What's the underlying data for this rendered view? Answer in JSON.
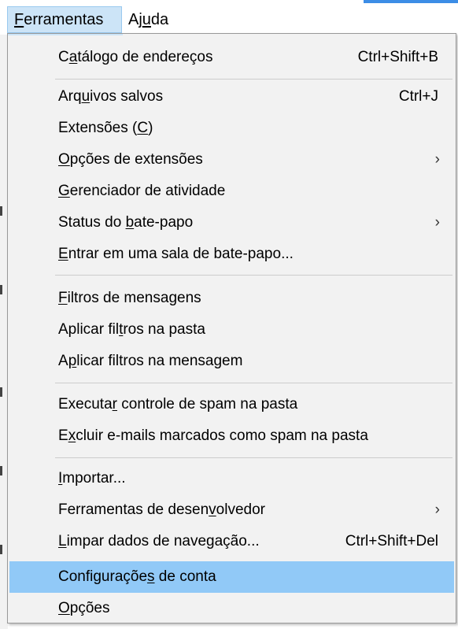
{
  "menubar": {
    "items": [
      {
        "pre": "",
        "key": "F",
        "post": "erramentas"
      },
      {
        "pre": "Aj",
        "key": "u",
        "post": "da"
      }
    ]
  },
  "menu": {
    "items": [
      {
        "pre": "C",
        "key": "a",
        "post": "tálogo de endereços",
        "shortcut": "Ctrl+Shift+B",
        "submenu": false
      },
      {
        "pre": "Arq",
        "key": "u",
        "post": "ivos salvos",
        "shortcut": "Ctrl+J",
        "submenu": false
      },
      {
        "pre": "Extensões (",
        "key": "C",
        "post": ")",
        "shortcut": "",
        "submenu": false
      },
      {
        "pre": "",
        "key": "O",
        "post": "pções de extensões",
        "shortcut": "",
        "submenu": true,
        "arrow": "›"
      },
      {
        "pre": "",
        "key": "G",
        "post": "erenciador de atividade",
        "shortcut": "",
        "submenu": false
      },
      {
        "pre": "Status do ",
        "key": "b",
        "post": "ate-papo",
        "shortcut": "",
        "submenu": true,
        "arrow": "›"
      },
      {
        "pre": "",
        "key": "E",
        "post": "ntrar em uma sala de bate-papo...",
        "shortcut": "",
        "submenu": false
      },
      {
        "pre": "",
        "key": "F",
        "post": "iltros de mensagens",
        "shortcut": "",
        "submenu": false
      },
      {
        "pre": "Aplicar fil",
        "key": "t",
        "post": "ros na pasta",
        "shortcut": "",
        "submenu": false
      },
      {
        "pre": "A",
        "key": "p",
        "post": "licar filtros na mensagem",
        "shortcut": "",
        "submenu": false
      },
      {
        "pre": "Executa",
        "key": "r",
        "post": " controle de spam na pasta",
        "shortcut": "",
        "submenu": false
      },
      {
        "pre": "E",
        "key": "x",
        "post": "cluir e-mails marcados como spam na pasta",
        "shortcut": "",
        "submenu": false
      },
      {
        "pre": "",
        "key": "I",
        "post": "mportar...",
        "shortcut": "",
        "submenu": false
      },
      {
        "pre": "Ferramentas de desen",
        "key": "v",
        "post": "olvedor",
        "shortcut": "",
        "submenu": true,
        "arrow": "›"
      },
      {
        "pre": "",
        "key": "L",
        "post": "impar dados de navegação...",
        "shortcut": "Ctrl+Shift+Del",
        "submenu": false
      },
      {
        "pre": "Configuraçõe",
        "key": "s",
        "post": " de conta",
        "shortcut": "",
        "submenu": false,
        "highlighted": true
      },
      {
        "pre": "",
        "key": "O",
        "post": "pções",
        "shortcut": "",
        "submenu": false
      }
    ]
  },
  "colors": {
    "highlight": "#91c9f7",
    "menubar_open": "#cce4f7",
    "menu_bg": "#f2f2f2"
  }
}
